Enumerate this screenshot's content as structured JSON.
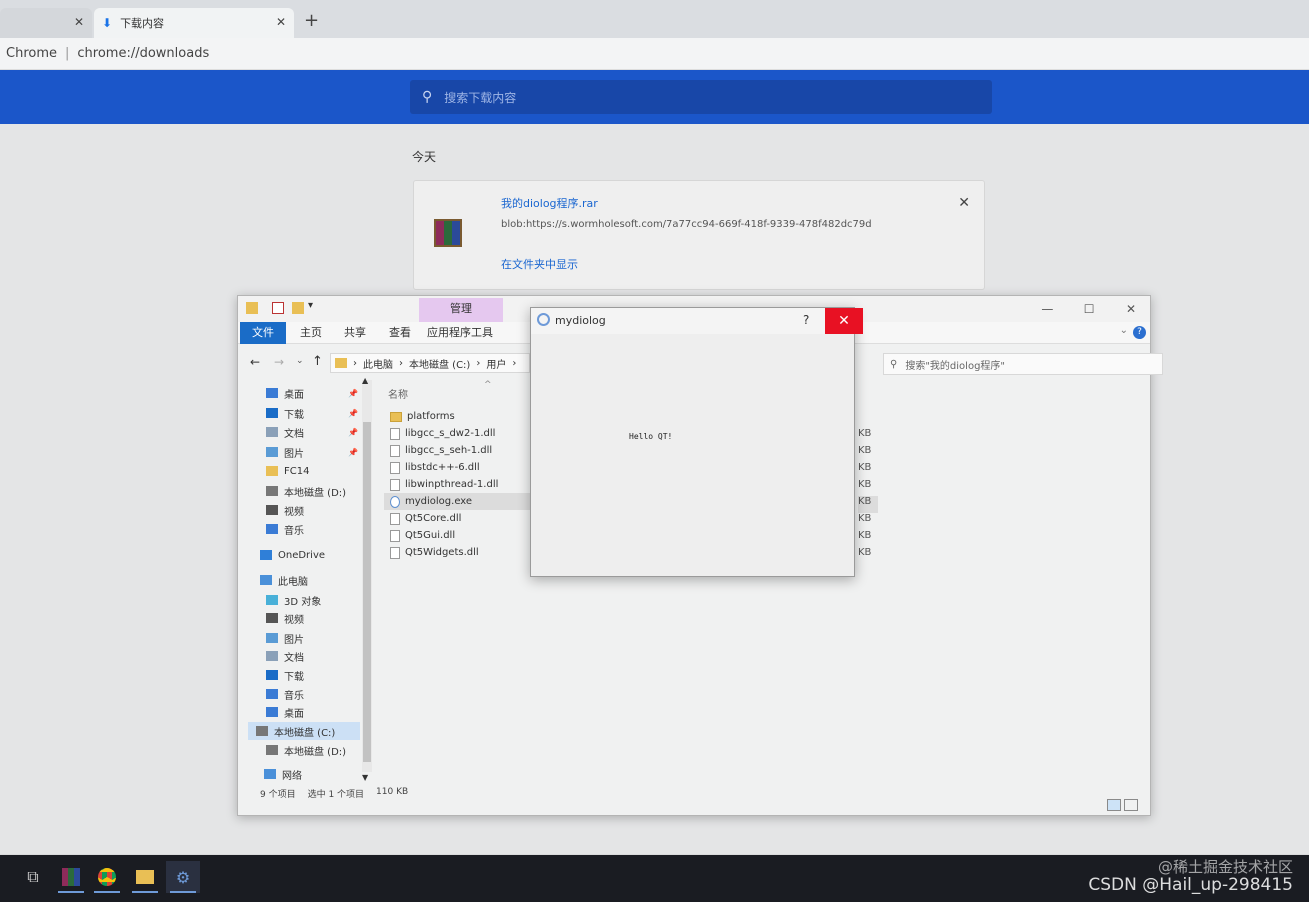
{
  "chrome": {
    "tabs": [
      {
        "label": "",
        "close": "✕"
      },
      {
        "label": "下载内容",
        "close": "✕"
      }
    ],
    "new_tab": "+",
    "address": {
      "site": "Chrome",
      "url": "chrome://downloads"
    }
  },
  "downloads": {
    "search_placeholder": "搜索下载内容",
    "date_header": "今天",
    "item": {
      "file_name": "我的diolog程序.rar",
      "url": "blob:https://s.wormholesoft.com/7a77cc94-669f-418f-9339-478f482dc79d",
      "show_in_folder": "在文件夹中显示",
      "close": "✕"
    }
  },
  "explorer": {
    "manage_tab": "管理",
    "ribbon_tabs": [
      "文件",
      "主页",
      "共享",
      "查看",
      "应用程序工具"
    ],
    "ribbon_help": "?",
    "win_controls": {
      "minimize": "—",
      "maximize": "☐",
      "close": "✕"
    },
    "breadcrumb": [
      "此电脑",
      "本地磁盘 (C:)",
      "用户"
    ],
    "search_placeholder": "搜索\"我的diolog程序\"",
    "nav_items": [
      {
        "label": "桌面",
        "pinned": true
      },
      {
        "label": "下载",
        "pinned": true
      },
      {
        "label": "文档",
        "pinned": true
      },
      {
        "label": "图片",
        "pinned": true
      },
      {
        "label": "FC14",
        "pinned": false
      },
      {
        "label": "本地磁盘 (D:)",
        "pinned": false
      },
      {
        "label": "视频",
        "pinned": false
      },
      {
        "label": "音乐",
        "pinned": false
      },
      {
        "label": "OneDrive",
        "pinned": false
      },
      {
        "label": "此电脑",
        "pinned": false
      },
      {
        "label": "3D 对象",
        "pinned": false
      },
      {
        "label": "视频",
        "pinned": false
      },
      {
        "label": "图片",
        "pinned": false
      },
      {
        "label": "文档",
        "pinned": false
      },
      {
        "label": "下载",
        "pinned": false
      },
      {
        "label": "音乐",
        "pinned": false
      },
      {
        "label": "桌面",
        "pinned": false
      },
      {
        "label": "本地磁盘 (C:)",
        "pinned": false
      },
      {
        "label": "本地磁盘 (D:)",
        "pinned": false
      },
      {
        "label": "网络",
        "pinned": false
      }
    ],
    "column_name": "名称",
    "files": [
      {
        "name": "platforms",
        "type": "folder",
        "size": ""
      },
      {
        "name": "libgcc_s_dw2-1.dll",
        "type": "dll",
        "size": "KB"
      },
      {
        "name": "libgcc_s_seh-1.dll",
        "type": "dll",
        "size": "KB"
      },
      {
        "name": "libstdc++-6.dll",
        "type": "dll",
        "size": "KB"
      },
      {
        "name": "libwinpthread-1.dll",
        "type": "dll",
        "size": "KB"
      },
      {
        "name": "mydiolog.exe",
        "type": "exe",
        "size": "KB"
      },
      {
        "name": "Qt5Core.dll",
        "type": "dll",
        "size": "KB"
      },
      {
        "name": "Qt5Gui.dll",
        "type": "dll",
        "size": "KB"
      },
      {
        "name": "Qt5Widgets.dll",
        "type": "dll",
        "size": "KB"
      }
    ],
    "status": {
      "count": "9 个项目",
      "selected": "选中 1 个项目",
      "size": "110 KB"
    }
  },
  "qt_dialog": {
    "title": "mydiolog",
    "help": "?",
    "close": "✕",
    "hello": "Hello QT!"
  },
  "watermark": {
    "line1": "@稀土掘金技术社区",
    "line2": "CSDN @Hail_up-298415"
  },
  "colors": {
    "accent": "#1b56c9",
    "link": "#1a66d0",
    "close_red": "#e81123",
    "manage_tab": "#e5c8ef"
  }
}
